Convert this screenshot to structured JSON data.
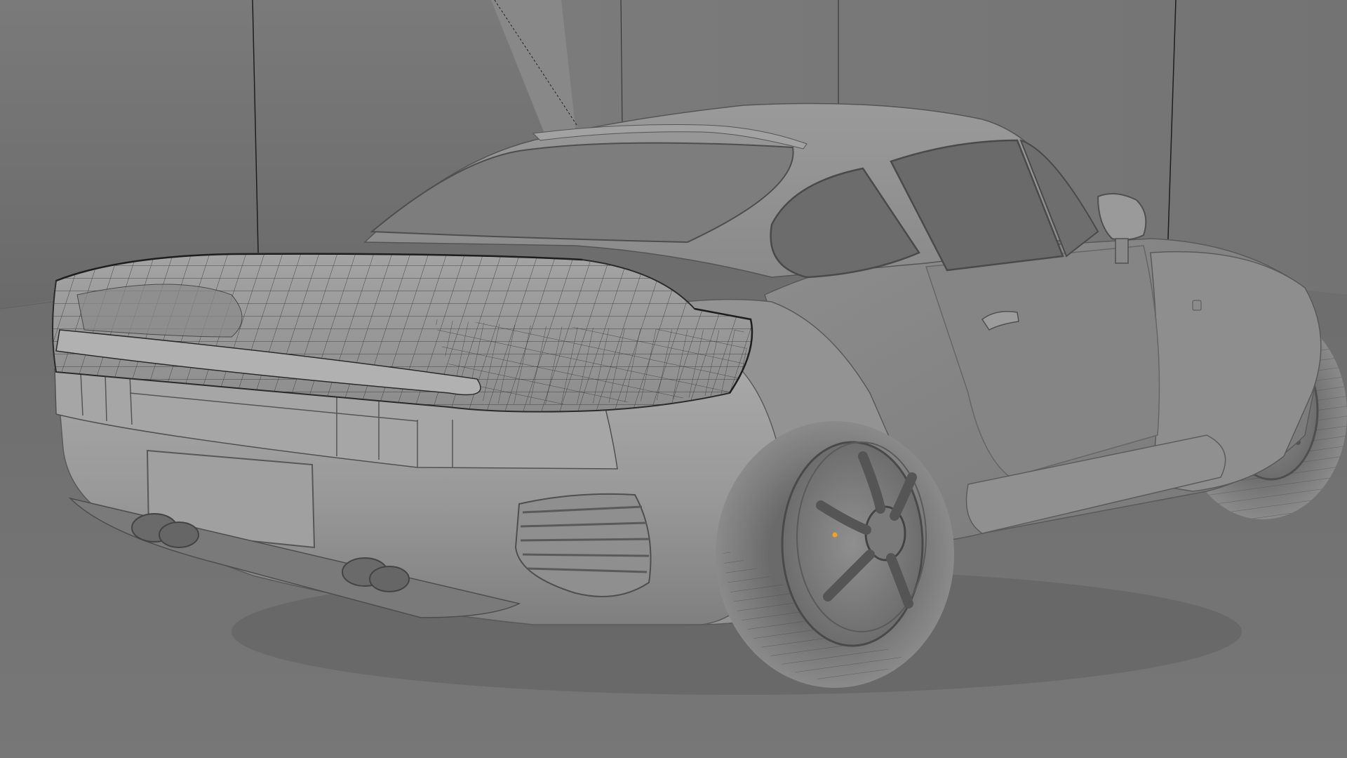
{
  "viewport": {
    "mode": "solid-shading",
    "colors": {
      "background_wall": "#6e6e6e",
      "floor": "#717171",
      "car_body": "#9b9b9b",
      "car_dark": "#5e5e5e",
      "glass": "#6f6f6f",
      "wireframe": "#2a2a2a",
      "highlight": "#b9b9b9",
      "origin_marker": "#f4a020"
    },
    "objects": [
      {
        "name": "car-body",
        "type": "mesh"
      },
      {
        "name": "rear-wing-edit-mesh",
        "type": "mesh",
        "edit_mode": true
      },
      {
        "name": "rear-wheel",
        "type": "mesh"
      },
      {
        "name": "front-wheel",
        "type": "mesh"
      },
      {
        "name": "backdrop-wall",
        "type": "mesh"
      },
      {
        "name": "floor-plane",
        "type": "mesh"
      }
    ]
  }
}
